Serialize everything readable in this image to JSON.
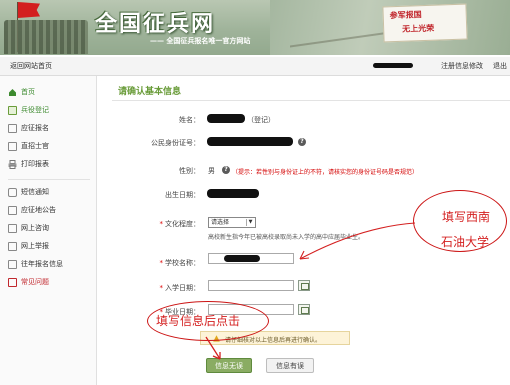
{
  "header": {
    "logo": "全国征兵网",
    "tagline": "—— 全国征兵报名唯一官方网站",
    "slogan_line1": "参军报国",
    "slogan_line2": "无上光荣"
  },
  "topbar": {
    "back_label": "返回网站首页",
    "links": [
      "注册信息修改",
      "退出"
    ]
  },
  "sidebar": {
    "group1": [
      {
        "label": "首页",
        "icon": "home-icon",
        "active": true
      },
      {
        "label": "兵役登记",
        "icon": "register-icon"
      },
      {
        "label": "应征报名",
        "icon": "form-icon"
      },
      {
        "label": "直招士官",
        "icon": "form-icon"
      },
      {
        "label": "打印报表",
        "icon": "printer-icon"
      }
    ],
    "group2": [
      {
        "label": "短信通知",
        "icon": "message-icon"
      },
      {
        "label": "应征地公告",
        "icon": "notice-icon"
      },
      {
        "label": "网上咨询",
        "icon": "chat-icon"
      },
      {
        "label": "网上举报",
        "icon": "report-icon"
      },
      {
        "label": "往年报名信息",
        "icon": "history-icon"
      },
      {
        "label": "常见问题",
        "icon": "question-icon"
      }
    ]
  },
  "main": {
    "title": "请确认基本信息",
    "name_label": "姓名：",
    "name_suffix": "（登记）",
    "id_label": "公民身份证号：",
    "gender_label": "性别：",
    "gender_value": "男",
    "gender_warning": "（提示：若性别与身份证上的不符，请核实您的身份证号码是否规范）",
    "dob_label": "出生日期：",
    "education_label": "文化程度：",
    "education_value": "请选择",
    "education_hint": "高校新生指今年已被高校录取尚未入学的高中应届毕业生。",
    "school_label": "学校名称：",
    "enroll_label": "入学日期：",
    "grad_label": "毕业日期：",
    "confirm_text": "请仔细核对以上信息后再进行确认。",
    "confirm_button": "信息无误",
    "error_button": "信息有误"
  },
  "annotations": {
    "school_note_line1": "填写西南",
    "school_note_line2": "石油大学",
    "click_note": "填写信息后点击",
    "color": "#d42020"
  },
  "colors": {
    "accent": "#6a9c3a",
    "required": "#dd0000"
  }
}
